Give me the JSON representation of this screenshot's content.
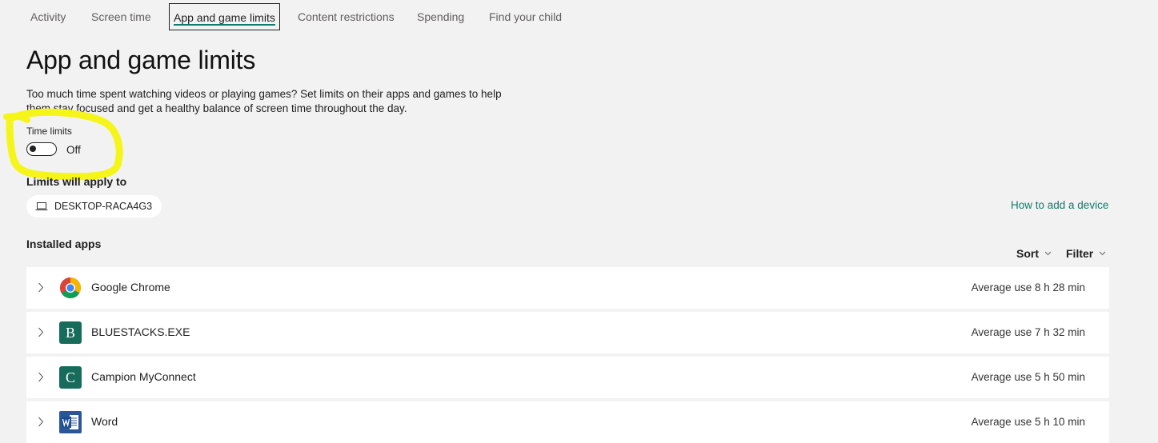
{
  "nav": {
    "tabs": [
      {
        "label": "Activity"
      },
      {
        "label": "Screen time"
      },
      {
        "label": "App and game limits"
      },
      {
        "label": "Content restrictions"
      },
      {
        "label": "Spending"
      },
      {
        "label": "Find your child"
      }
    ],
    "active_tab": "App and game limits"
  },
  "page": {
    "title": "App and game limits",
    "description_line1": "Too much time spent watching videos or playing games? Set limits on their apps and games to help",
    "description_line2": "them stay focused and get a healthy balance of screen time throughout the day."
  },
  "time_limits": {
    "label": "Time limits",
    "state": "Off",
    "enabled": false
  },
  "limits_apply": {
    "label": "Limits will apply to",
    "device": "DESKTOP-RACA4G3",
    "device_icon": "laptop-icon",
    "how_to_link": "How to add a device"
  },
  "apps": {
    "heading": "Installed apps",
    "sort_label": "Sort",
    "filter_label": "Filter",
    "items": [
      {
        "name": "Google Chrome",
        "icon": "chrome-icon",
        "avg": "Average use 8 h 28 min"
      },
      {
        "name": "BLUESTACKS.EXE",
        "icon": "letter-b-icon",
        "letter": "B",
        "avg": "Average use 7 h 32 min"
      },
      {
        "name": "Campion MyConnect",
        "icon": "letter-c-icon",
        "letter": "C",
        "avg": "Average use 5 h 50 min"
      },
      {
        "name": "Word",
        "icon": "word-icon",
        "avg": "Average use 5 h 10 min"
      }
    ]
  },
  "colors": {
    "accent": "#0f7c6b",
    "background": "#f2f2f2",
    "highlight": "#f5f51a",
    "app_tile": "#176b5b"
  }
}
